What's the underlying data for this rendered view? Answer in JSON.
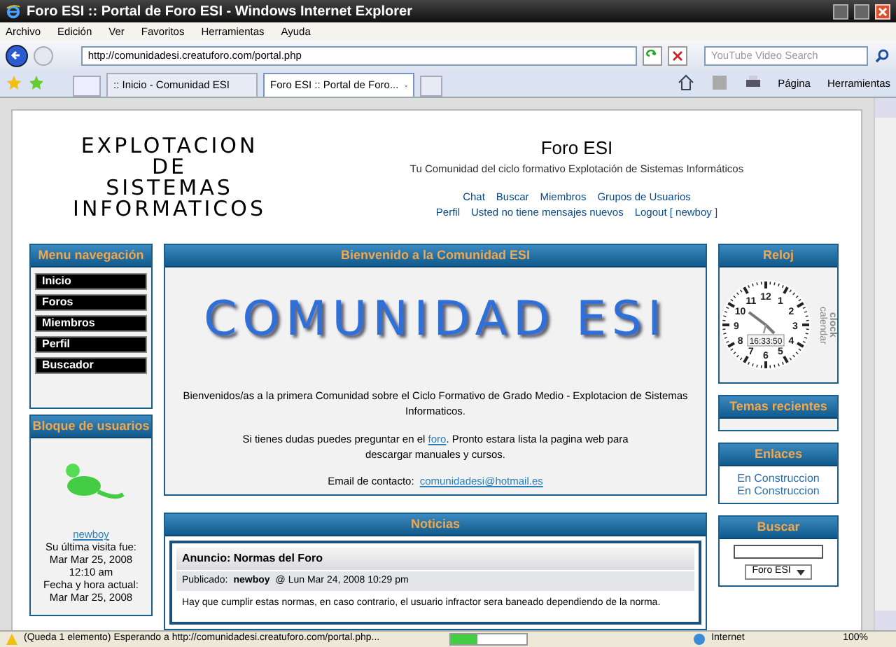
{
  "window": {
    "title": "Foro ESI :: Portal de Foro ESI - Windows Internet Explorer"
  },
  "menu": [
    "Archivo",
    "Edición",
    "Ver",
    "Favoritos",
    "Herramientas",
    "Ayuda"
  ],
  "address": {
    "value": "http://comunidadesi.creatuforo.com/portal.php"
  },
  "search": {
    "placeholder": "YouTube Video Search"
  },
  "tabs": [
    {
      "label": ":: Inicio - Comunidad ESI",
      "selected": false
    },
    {
      "label": "Foro ESI :: Portal de Foro...",
      "selected": true
    }
  ],
  "toolbar": [
    "Página",
    "Herramientas"
  ],
  "header": {
    "logo": [
      "EXPLOTACION",
      "DE",
      "SISTEMAS",
      "INFORMATICOS"
    ],
    "title": "Foro ESI",
    "subtitle": "Tu Comunidad del ciclo formativo Explotación de Sistemas Informáticos",
    "links_row_1": [
      "Chat",
      "Buscar",
      "Miembros",
      "Grupos de Usuarios"
    ],
    "links_row_2": [
      "Perfil",
      "Usted no tiene mensajes nuevos",
      "Logout [ newboy ]"
    ]
  },
  "nav": {
    "title": "Menu navegación",
    "items": [
      "Inicio",
      "Foros",
      "Miembros",
      "Perfil",
      "Buscador"
    ]
  },
  "users": {
    "title": "Bloque de usuarios",
    "username": "newboy",
    "lines": [
      "Su última visita fue:",
      "Mar Mar 25, 2008",
      "12:10 am",
      "Fecha y hora actual:",
      "Mar Mar 25, 2008"
    ]
  },
  "welcome": {
    "title": "Bienvenido a la Comunidad ESI",
    "banner": "COMUNIDAD ESI",
    "paragraph_1": "Bienvenidos/as a la primera Comunidad sobre el Ciclo Formativo de Grado Medio - Explotacion de Sistemas Informaticos.",
    "paragraph_2_before": "Si tienes dudas puedes preguntar en el",
    "paragraph_2_link": "foro",
    "paragraph_2_after": ". Pronto estara lista la pagina web para descargar manuales y cursos.",
    "email_label": "Email de contacto:",
    "email": "comunidadesi@hotmail.es"
  },
  "news": {
    "title": "Noticias",
    "post_title": "Anuncio: Normas del Foro",
    "posted_label": "Publicado:",
    "author": "newboy",
    "date": "@ Lun Mar 24, 2008 10:29 pm",
    "body": "Hay que cumplir estas normas, en caso contrario, el usuario infractor sera baneado dependiendo de la norma."
  },
  "clock": {
    "title": "Reloj",
    "numerals": [
      "11",
      "12",
      "1",
      "10",
      "2",
      "9",
      "3",
      "8",
      "4",
      "7",
      "5",
      "6"
    ],
    "time": "16:33:50",
    "brand_1": "calendar",
    "brand_2": "clock"
  },
  "recent": {
    "title": "Temas recientes"
  },
  "links": {
    "title": "Enlaces",
    "items": [
      "En Construccion",
      "En Construccion"
    ]
  },
  "search_box": {
    "title": "Buscar",
    "scope": "Foro ESI"
  },
  "status_bar": {
    "text": "(Queda 1 elemento) Esperando a http://comunidadesi.creatuforo.com/portal.php...",
    "level": 0.35,
    "zone": "Internet",
    "zoom": "100%"
  }
}
